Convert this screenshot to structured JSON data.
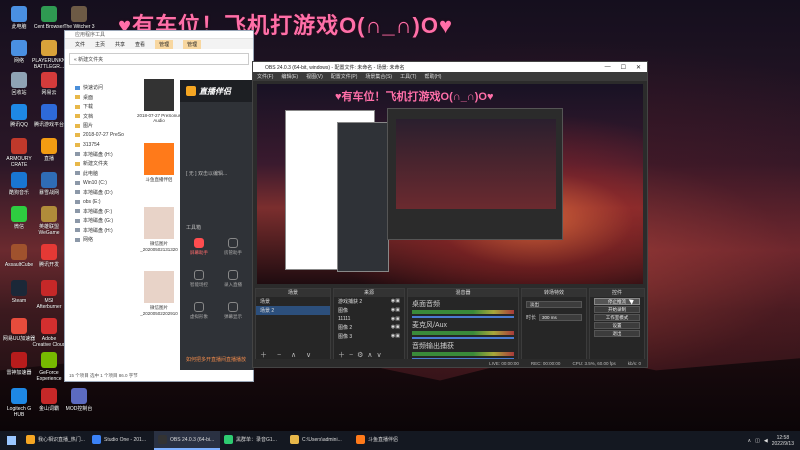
{
  "overlay_title": "♥有车位！飞机打游戏O(∩_∩)O♥",
  "desktop_icons": [
    {
      "label": "此电脑",
      "color": "#4a90e2"
    },
    {
      "label": "Cent Browser",
      "color": "#2f9a52"
    },
    {
      "label": "The Witcher 3 Wild Hunt",
      "color": "#6d5a45"
    },
    {
      "label": "网络",
      "color": "#4a90e2"
    },
    {
      "label": "PLAYERUNKNOWN'S BATTLEGR...",
      "color": "#d9a23a"
    },
    {
      "label": "回收站",
      "color": "#8fa3b5"
    },
    {
      "label": "网易云",
      "color": "#d43b3b"
    },
    {
      "label": "腾讯QQ",
      "color": "#1e88e5"
    },
    {
      "label": "腾讯游戏平台",
      "color": "#2e6ad9"
    },
    {
      "label": "ARMOURY CRATE",
      "color": "#c0392b"
    },
    {
      "label": "直播",
      "color": "#f39c12"
    },
    {
      "label": "酷狗音乐",
      "color": "#1976d2"
    },
    {
      "label": "暴雪战网",
      "color": "#2f6cb5"
    },
    {
      "label": "微信",
      "color": "#2ecc40"
    },
    {
      "label": "英雄联盟WeGame",
      "color": "#b08c3a"
    },
    {
      "label": "AssaultCube",
      "color": "#a0522d"
    },
    {
      "label": "腾讯开发",
      "color": "#e53935"
    },
    {
      "label": "Steam",
      "color": "#1b2838"
    },
    {
      "label": "MSI Afterburner",
      "color": "#c62828"
    },
    {
      "label": "网易UU加速器",
      "color": "#e74c3c"
    },
    {
      "label": "Adobe Creative Cloud",
      "color": "#d32f2f"
    },
    {
      "label": "雷神加速器",
      "color": "#b71c1c"
    },
    {
      "label": "GeForce Experience",
      "color": "#76b900"
    },
    {
      "label": "Logitech G HUB",
      "color": "#1e88e5"
    },
    {
      "label": "金山词霸",
      "color": "#c62828"
    },
    {
      "label": "MOD控制台",
      "color": "#5c6bc0"
    }
  ],
  "explorer": {
    "tabs": [
      "文件",
      "主页",
      "共享",
      "查看",
      "管理",
      "管理"
    ],
    "ctx_tab_1": "应用程序工具",
    "address": "« 新建文件夹",
    "nav": [
      {
        "label": "快速访问",
        "kind": "star"
      },
      {
        "label": "桌面",
        "kind": "folder"
      },
      {
        "label": "下载",
        "kind": "folder"
      },
      {
        "label": "文档",
        "kind": "folder"
      },
      {
        "label": "图片",
        "kind": "folder"
      },
      {
        "label": "2018-07-27 PreSo",
        "kind": "folder"
      },
      {
        "label": "313754",
        "kind": "folder"
      },
      {
        "label": "本地磁盘 (H:)",
        "kind": "drive"
      },
      {
        "label": "新建文件夹",
        "kind": "folder"
      },
      {
        "label": "此电脑",
        "kind": "drive"
      },
      {
        "label": "Win10 (C:)",
        "kind": "drive"
      },
      {
        "label": "本地磁盘 (D:)",
        "kind": "drive"
      },
      {
        "label": "obs (E:)",
        "kind": "drive"
      },
      {
        "label": "本地磁盘 (F:)",
        "kind": "drive"
      },
      {
        "label": "本地磁盘 (G:)",
        "kind": "drive"
      },
      {
        "label": "本地磁盘 (H:)",
        "kind": "drive"
      },
      {
        "label": "网络",
        "kind": "drive"
      }
    ],
    "files": [
      {
        "label": "2018-07-27 PreSonus Audio",
        "color": "#333"
      },
      {
        "label": "斗鱼直播伴侣",
        "color": "#ff7a1a"
      },
      {
        "label": "微信图片_20200502131320",
        "color": "#e8d3c8"
      },
      {
        "label": "微信图片_20200502202910",
        "color": "#e8d3c8"
      }
    ],
    "status": "15 个项目    选中 1 个项目 86.0 字节"
  },
  "live_app": {
    "title": "直播伴侣",
    "hint": "[ 无 ] 双击以编辑...",
    "tools_label": "工具箱",
    "tools": [
      {
        "label": "屏幕助手",
        "active": true
      },
      {
        "label": "房管助手",
        "active": false
      },
      {
        "label": "智能场控",
        "active": false
      },
      {
        "label": "录入直播",
        "active": false
      },
      {
        "label": "虚拟形象",
        "active": false
      },
      {
        "label": "弹幕显示",
        "active": false
      }
    ],
    "footer_tip": "如何把多开直播间直播播放"
  },
  "obs": {
    "title": "OBS 24.0.3 (64-bit, windows) - 配置文件: 未命名 - 场景: 未命名",
    "menu": [
      "文件(F)",
      "编辑(E)",
      "视图(V)",
      "配置文件(P)",
      "场景集合(S)",
      "工具(T)",
      "帮助(H)"
    ],
    "docks": {
      "scenes": {
        "title": "场景",
        "items": [
          "场景",
          "场景 2"
        ],
        "selected": 1
      },
      "sources": {
        "title": "来源",
        "items": [
          "游戏捕获 2",
          "图像",
          "11111",
          "图像 2",
          "图像 3"
        ]
      },
      "mixer": {
        "title": "混音器",
        "tracks": [
          "桌面音频",
          "麦克风/Aux",
          "音频输出捕获"
        ]
      },
      "transitions": {
        "title": "转场特效",
        "value": "淡出",
        "duration_label": "时长",
        "duration": "300 ms"
      },
      "controls": {
        "title": "控件",
        "buttons": [
          "停止推流",
          "开始录制",
          "工作室模式",
          "设置",
          "退出"
        ]
      }
    },
    "status": [
      "LIVE: 00:00:00",
      "REC: 00:00:00",
      "CPU: 3.5%, 60.00 fps",
      "kb/s: 0"
    ]
  },
  "taskbar": {
    "items": [
      {
        "label": "我心相识直播_热门...",
        "color": "#f5a623",
        "active": false
      },
      {
        "label": "Studio One - 201...",
        "color": "#3b82f6",
        "active": false
      },
      {
        "label": "OBS 24.0.3 (64-bi...",
        "color": "#333",
        "active": true
      },
      {
        "label": "黑群单：录音G1...",
        "color": "#2ecc71",
        "active": false
      },
      {
        "label": "C:\\Users\\admini...",
        "color": "#e8b84a",
        "active": false
      },
      {
        "label": "斗鱼直播伴侣",
        "color": "#ff7a1a",
        "active": false
      }
    ],
    "time": "12:58",
    "date": "2022/9/13"
  }
}
